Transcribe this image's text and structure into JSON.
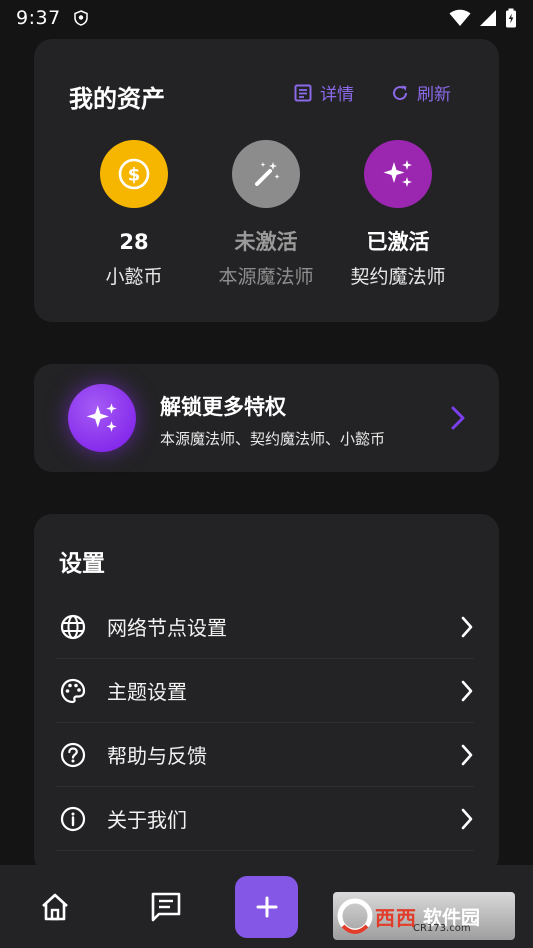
{
  "status_bar": {
    "time": "9:37"
  },
  "assets": {
    "title": "我的资产",
    "detail_label": "详情",
    "refresh_label": "刷新",
    "items": [
      {
        "primary": "28",
        "secondary": "小懿币",
        "color": "#f6b600",
        "icon": "coin-icon"
      },
      {
        "primary": "未激活",
        "secondary": "本源魔法师",
        "color": "#8c8c8c",
        "icon": "magic-wand-icon"
      },
      {
        "primary": "已激活",
        "secondary": "契约魔法师",
        "color": "#9b27b0",
        "icon": "sparkles-icon"
      }
    ]
  },
  "unlock": {
    "title": "解锁更多特权",
    "subtitle": "本源魔法师、契约魔法师、小懿币"
  },
  "settings": {
    "title": "设置",
    "items": [
      {
        "label": "网络节点设置",
        "icon": "globe-icon"
      },
      {
        "label": "主题设置",
        "icon": "palette-icon"
      },
      {
        "label": "帮助与反馈",
        "icon": "help-icon"
      },
      {
        "label": "关于我们",
        "icon": "info-icon"
      }
    ]
  },
  "bottom_nav": {
    "items": [
      "home-icon",
      "message-icon",
      "add-icon",
      "profile-icon"
    ]
  },
  "watermark": {
    "text1": "西西",
    "text2": "软件园",
    "url": "CR173.com"
  },
  "colors": {
    "accent": "#8457e6",
    "card": "#232325",
    "background": "#141414"
  }
}
